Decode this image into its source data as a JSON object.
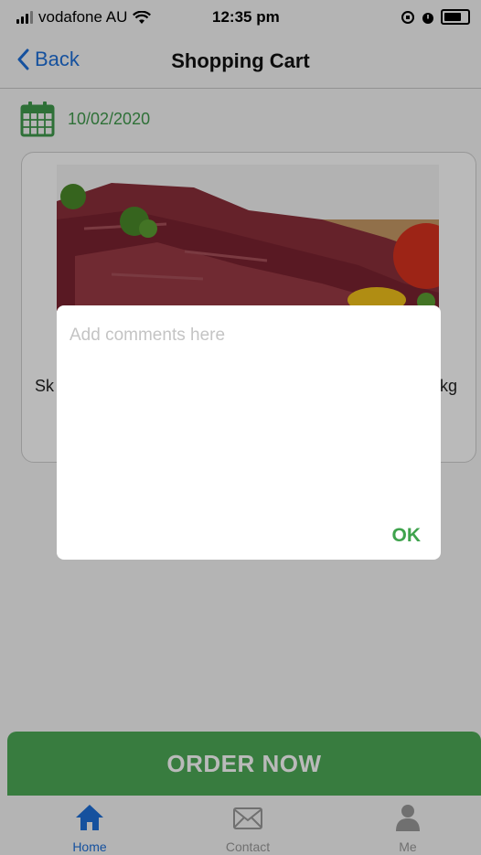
{
  "status_bar": {
    "carrier": "vodafone AU",
    "time": "12:35 pm"
  },
  "nav": {
    "back_label": "Back",
    "title": "Shopping Cart"
  },
  "cart": {
    "date": "10/02/2020",
    "item_name_partial": "Sk",
    "item_unit_partial": "kg"
  },
  "dialog": {
    "placeholder": "Add comments here",
    "value": "",
    "ok_label": "OK"
  },
  "order_button": {
    "label": "ORDER NOW"
  },
  "tabs": [
    {
      "label": "Home",
      "icon": "home-icon",
      "active": true
    },
    {
      "label": "Contact",
      "icon": "envelope-icon",
      "active": false
    },
    {
      "label": "Me",
      "icon": "person-icon",
      "active": false
    }
  ],
  "colors": {
    "accent_green": "#4daa57",
    "link_blue": "#1e6fd9",
    "tab_active": "#1e6fd9",
    "tab_inactive": "#9a9a9a"
  }
}
